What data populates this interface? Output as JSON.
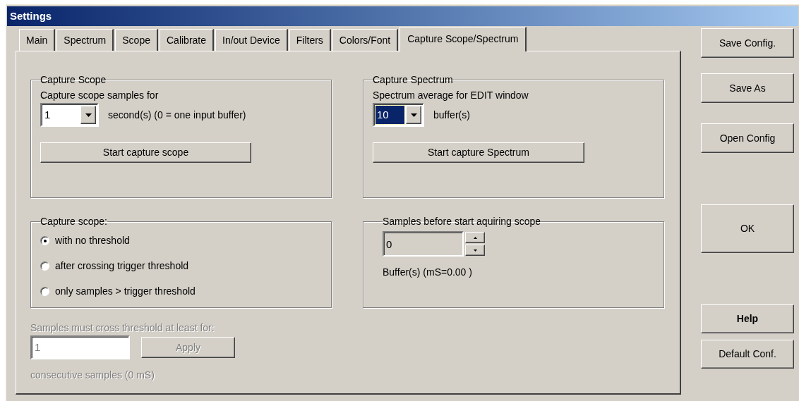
{
  "window": {
    "title": "Settings"
  },
  "tabs": [
    {
      "label": "Main",
      "selected": false
    },
    {
      "label": "Spectrum",
      "selected": false
    },
    {
      "label": "Scope",
      "selected": false
    },
    {
      "label": "Calibrate",
      "selected": false
    },
    {
      "label": "In/out Device",
      "selected": false
    },
    {
      "label": "Filters",
      "selected": false
    },
    {
      "label": "Colors/Font",
      "selected": false
    },
    {
      "label": "Capture Scope/Spectrum",
      "selected": true
    }
  ],
  "capture_scope": {
    "title": "Capture Scope",
    "label": "Capture scope samples for",
    "select": {
      "value": "1",
      "focused": false
    },
    "unit": "second(s) (0 = one input buffer)",
    "button": "Start capture scope"
  },
  "capture_spectrum": {
    "title": "Capture Spectrum",
    "label": "Spectrum average for EDIT window",
    "select": {
      "value": "10",
      "focused": true
    },
    "unit": "buffer(s)",
    "button": "Start capture Spectrum"
  },
  "capture_mode": {
    "title": "Capture scope:",
    "options": [
      {
        "label": "with no threshold",
        "selected": true
      },
      {
        "label": "after crossing trigger threshold",
        "selected": false
      },
      {
        "label": "only samples > trigger threshold",
        "selected": false
      }
    ]
  },
  "samples_before": {
    "title": "Samples before start aquiring scope",
    "spinner": {
      "value": "0"
    },
    "note": "Buffer(s) (mS=0.00 )"
  },
  "threshold": {
    "disabled": true,
    "label": "Samples must cross threshold at least for:",
    "field": {
      "value": "1"
    },
    "button": "Apply",
    "note": "consecutive samples (0 mS)"
  },
  "side_buttons": [
    {
      "label": "Save Config.",
      "default": false
    },
    {
      "label": "Save As",
      "default": false
    },
    {
      "label": "Open Config",
      "default": false
    },
    {
      "label": "OK",
      "default": false
    },
    {
      "label": "Help",
      "default": true
    },
    {
      "label": "Default Conf.",
      "default": false
    }
  ]
}
